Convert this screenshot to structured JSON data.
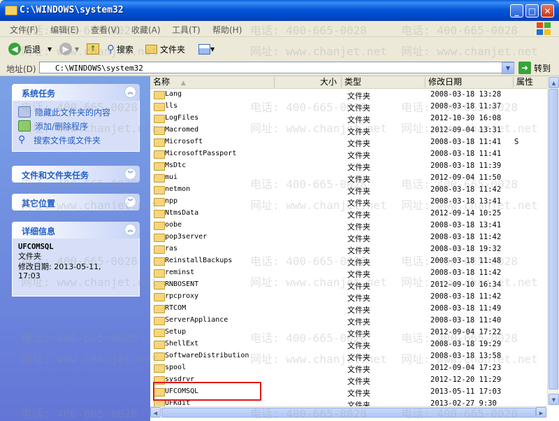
{
  "window": {
    "title": "C:\\WINDOWS\\system32"
  },
  "menu": [
    "文件(F)",
    "编辑(E)",
    "查看(V)",
    "收藏(A)",
    "工具(T)",
    "帮助(H)"
  ],
  "toolbar": {
    "back": "后退",
    "search": "搜索",
    "folders": "文件夹"
  },
  "address": {
    "label": "地址(D)",
    "value": "C:\\WINDOWS\\system32",
    "go": "转到"
  },
  "left": {
    "system_tasks": {
      "title": "系统任务",
      "items": [
        "隐藏此文件夹的内容",
        "添加/删除程序",
        "搜索文件或文件夹"
      ]
    },
    "file_tasks": {
      "title": "文件和文件夹任务"
    },
    "other_places": {
      "title": "其它位置"
    },
    "details": {
      "title": "详细信息",
      "name": "UFCOMSQL",
      "type": "文件夹",
      "modified": "修改日期: 2013-05-11, 17:03"
    }
  },
  "columns": {
    "name": "名称",
    "size": "大小",
    "type": "类型",
    "modified": "修改日期",
    "attr": "属性"
  },
  "files": [
    {
      "name": "Lang",
      "type": "文件夹",
      "date": "2008-03-18 13:28",
      "attr": ""
    },
    {
      "name": "lls",
      "type": "文件夹",
      "date": "2008-03-18 11:37",
      "attr": ""
    },
    {
      "name": "LogFiles",
      "type": "文件夹",
      "date": "2012-10-30 16:08",
      "attr": ""
    },
    {
      "name": "Macromed",
      "type": "文件夹",
      "date": "2012-09-04 13:31",
      "attr": ""
    },
    {
      "name": "Microsoft",
      "type": "文件夹",
      "date": "2008-03-18 11:41",
      "attr": "S"
    },
    {
      "name": "MicrosoftPassport",
      "type": "文件夹",
      "date": "2008-03-18 11:41",
      "attr": ""
    },
    {
      "name": "MsDtc",
      "type": "文件夹",
      "date": "2008-03-18 11:39",
      "attr": ""
    },
    {
      "name": "mui",
      "type": "文件夹",
      "date": "2012-09-04 11:50",
      "attr": ""
    },
    {
      "name": "netmon",
      "type": "文件夹",
      "date": "2008-03-18 11:42",
      "attr": ""
    },
    {
      "name": "npp",
      "type": "文件夹",
      "date": "2008-03-18 13:41",
      "attr": ""
    },
    {
      "name": "NtmsData",
      "type": "文件夹",
      "date": "2012-09-14 10:25",
      "attr": ""
    },
    {
      "name": "oobe",
      "type": "文件夹",
      "date": "2008-03-18 13:41",
      "attr": ""
    },
    {
      "name": "pop3server",
      "type": "文件夹",
      "date": "2008-03-18 11:42",
      "attr": ""
    },
    {
      "name": "ras",
      "type": "文件夹",
      "date": "2008-03-18 19:32",
      "attr": ""
    },
    {
      "name": "ReinstallBackups",
      "type": "文件夹",
      "date": "2008-03-18 11:48",
      "attr": ""
    },
    {
      "name": "reminst",
      "type": "文件夹",
      "date": "2008-03-18 11:42",
      "attr": ""
    },
    {
      "name": "RNBOSENT",
      "type": "文件夹",
      "date": "2012-09-10 16:34",
      "attr": ""
    },
    {
      "name": "rpcproxy",
      "type": "文件夹",
      "date": "2008-03-18 11:42",
      "attr": ""
    },
    {
      "name": "RTCOM",
      "type": "文件夹",
      "date": "2008-03-18 11:49",
      "attr": ""
    },
    {
      "name": "ServerAppliance",
      "type": "文件夹",
      "date": "2008-03-18 11:40",
      "attr": ""
    },
    {
      "name": "Setup",
      "type": "文件夹",
      "date": "2012-09-04 17:22",
      "attr": ""
    },
    {
      "name": "ShellExt",
      "type": "文件夹",
      "date": "2008-03-18 19:29",
      "attr": ""
    },
    {
      "name": "SoftwareDistribution",
      "type": "文件夹",
      "date": "2008-03-18 13:58",
      "attr": ""
    },
    {
      "name": "spool",
      "type": "文件夹",
      "date": "2012-09-04 17:23",
      "attr": ""
    },
    {
      "name": "sysdrvr",
      "type": "文件夹",
      "date": "2012-12-20 11:29",
      "attr": ""
    },
    {
      "name": "UFCOMSQL",
      "type": "文件夹",
      "date": "2013-05-11 17:03",
      "attr": ""
    },
    {
      "name": "UFKdit",
      "type": "文件夹",
      "date": "2013-02-27 9:30",
      "attr": ""
    }
  ],
  "watermark": {
    "phone": "电话: 400-665-0028",
    "site": "网址: www.chanjet.net"
  }
}
